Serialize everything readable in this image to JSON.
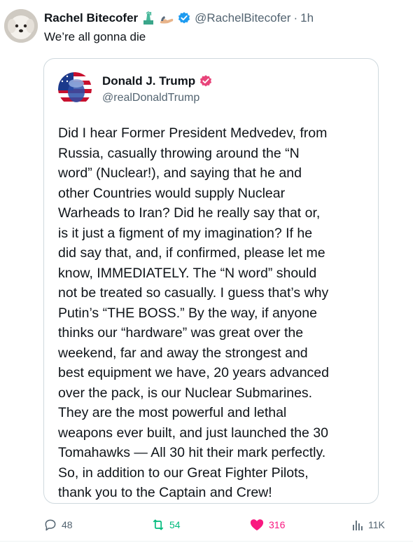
{
  "tweet": {
    "author_name": "Rachel Bitecofer",
    "handle": "@RachelBitecofer",
    "separator": "·",
    "time": "1h",
    "text": "We’re all gonna die",
    "name_emoji_icons": [
      "statue-of-liberty-icon",
      "flexed-arm-icon"
    ]
  },
  "quoted_post": {
    "author_name": "Donald J. Trump",
    "handle": "@realDonaldTrump",
    "badge": "verified-badge",
    "body_lines": [
      "Did I hear Former President Medvedev, from",
      "Russia, casually throwing around the “N",
      "word” (Nuclear!), and saying that he and",
      "other Countries would supply Nuclear",
      "Warheads to Iran? Did he really say that or,",
      "is it just a figment of my imagination? If he",
      "did say that, and, if confirmed, please let me",
      "know, IMMEDIATELY. The “N word” should",
      "not be treated so casually. I guess that’s why",
      "Putin’s “THE BOSS.” By the way, if anyone",
      "thinks our “hardware” was great over the",
      "weekend, far and away the strongest and",
      "best equipment we have, 20 years advanced",
      "over the pack, is our Nuclear Submarines.",
      "They are the most powerful and lethal",
      "weapons ever built, and just launched the 30",
      "Tomahawks — All 30 hit their mark perfectly.",
      "So, in addition to our Great Fighter Pilots,",
      "thank you to the Captain and Crew!"
    ]
  },
  "actions": {
    "replies": "48",
    "reposts": "54",
    "likes": "316",
    "views": "11K"
  },
  "colors": {
    "repost_active": "#00ba7c",
    "like_active": "#f91880",
    "verified_blue": "#1d9bf0",
    "verified_pink": "#e8447a",
    "muted_text": "#536471"
  }
}
